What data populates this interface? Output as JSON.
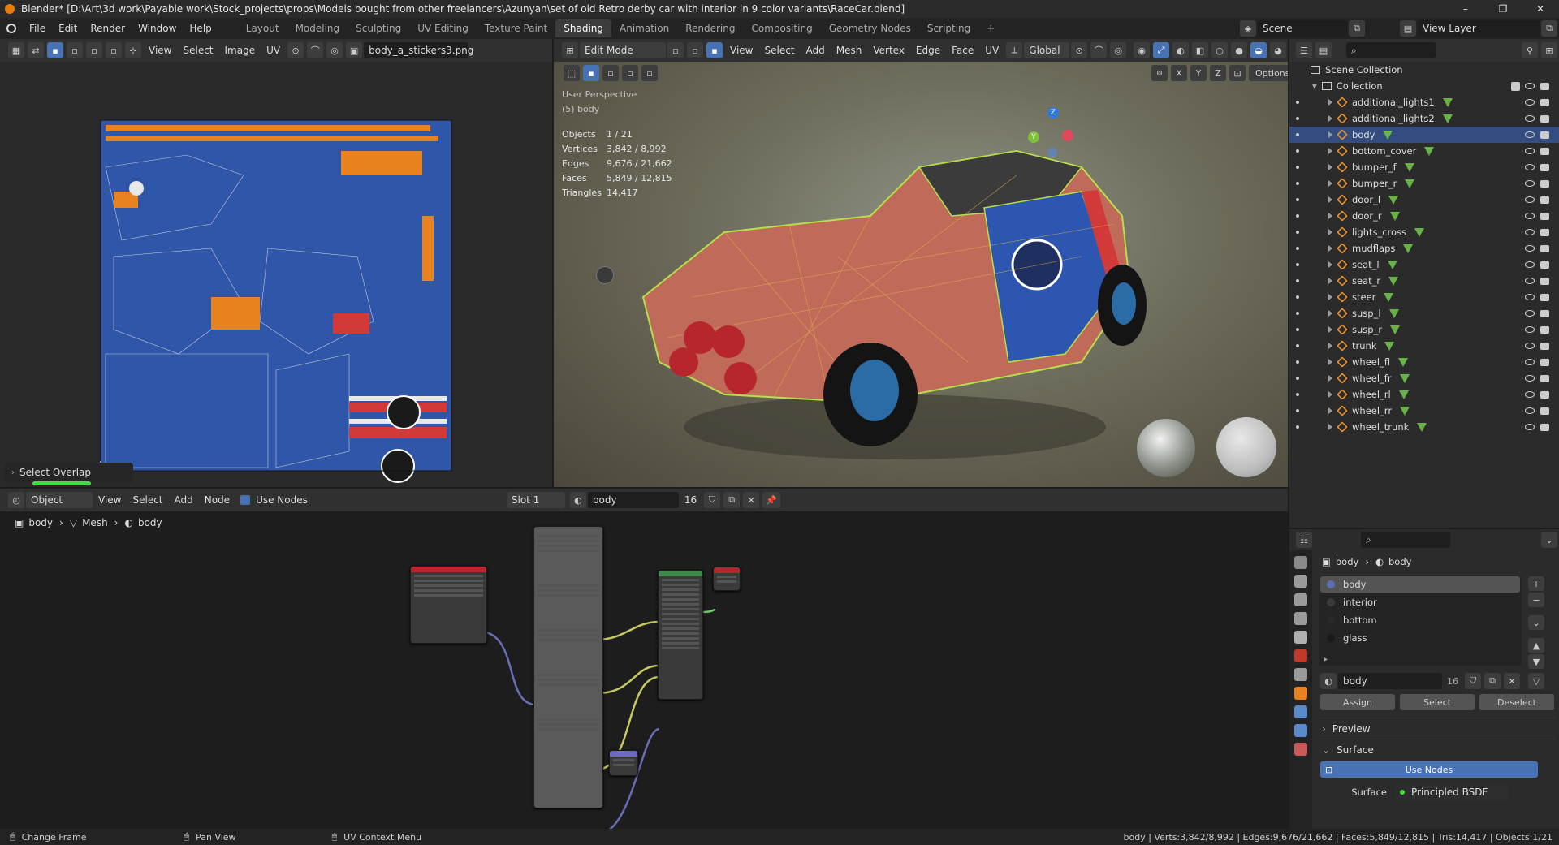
{
  "window": {
    "title": "Blender* [D:\\Art\\3d work\\Payable work\\Stock_projects\\props\\Models bought from other freelancers\\Azunyan\\set of old Retro derby car with interior in 9 color variants\\RaceCar.blend]",
    "minimize": "–",
    "maximize": "❐",
    "close": "✕"
  },
  "menu": [
    "File",
    "Edit",
    "Render",
    "Window",
    "Help"
  ],
  "workspaces": [
    "Layout",
    "Modeling",
    "Sculpting",
    "UV Editing",
    "Texture Paint",
    "Shading",
    "Animation",
    "Rendering",
    "Compositing",
    "Geometry Nodes",
    "Scripting",
    "+"
  ],
  "active_workspace": "Shading",
  "scene": {
    "name": "Scene",
    "view_layer": "View Layer"
  },
  "uv_editor": {
    "menus": [
      "View",
      "Select",
      "Image",
      "UV"
    ],
    "image_name": "body_a_stickers3.png",
    "overlay_panel": "Select Overlap"
  },
  "viewport": {
    "mode": "Edit Mode",
    "menus": [
      "View",
      "Select",
      "Add",
      "Mesh",
      "Vertex",
      "Edge",
      "Face",
      "UV"
    ],
    "transform": "Global",
    "options": "Options",
    "axes": [
      "X",
      "Y",
      "Z"
    ],
    "perspective": "User Perspective",
    "object": "(5) body",
    "stats": [
      {
        "label": "Objects",
        "value": "1 / 21"
      },
      {
        "label": "Vertices",
        "value": "3,842 / 8,992"
      },
      {
        "label": "Edges",
        "value": "9,676 / 21,662"
      },
      {
        "label": "Faces",
        "value": "5,849 / 12,815"
      },
      {
        "label": "Triangles",
        "value": "14,417"
      }
    ],
    "gizmo": {
      "x": "X",
      "y": "Y",
      "z": "Z"
    }
  },
  "node_editor": {
    "type": "Object",
    "menus": [
      "View",
      "Select",
      "Add",
      "Node"
    ],
    "use_nodes": "Use Nodes",
    "slot": "Slot 1",
    "material": "body",
    "users": "16",
    "breadcrumb": [
      "body",
      "Mesh",
      "body"
    ]
  },
  "outliner": {
    "root": "Scene Collection",
    "collection": "Collection",
    "items": [
      "additional_lights1",
      "additional_lights2",
      "body",
      "bottom_cover",
      "bumper_f",
      "bumper_r",
      "door_l",
      "door_r",
      "lights_cross",
      "mudflaps",
      "seat_l",
      "seat_r",
      "steer",
      "susp_l",
      "susp_r",
      "trunk",
      "wheel_fl",
      "wheel_fr",
      "wheel_rl",
      "wheel_rr",
      "wheel_trunk"
    ],
    "selected": "body"
  },
  "properties": {
    "breadcrumb": [
      "body",
      "body"
    ],
    "materials": [
      "body",
      "interior",
      "bottom",
      "glass"
    ],
    "material_colors": [
      "#5a6fb5",
      "#3a3a3a",
      "#2a2a2a",
      "#1a1a1a"
    ],
    "material_name": "body",
    "users": "16",
    "buttons": [
      "Assign",
      "Select",
      "Deselect"
    ],
    "sections": [
      "Preview",
      "Surface"
    ],
    "use_nodes": "Use Nodes",
    "surface_label": "Surface",
    "surface_value": "Principled BSDF"
  },
  "status": {
    "items": [
      "Change Frame",
      "Pan View",
      "UV Context Menu"
    ],
    "info": "body | Verts:3,842/8,992 | Edges:9,676/21,662 | Faces:5,849/12,815 | Tris:14,417 | Objects:1/21"
  }
}
